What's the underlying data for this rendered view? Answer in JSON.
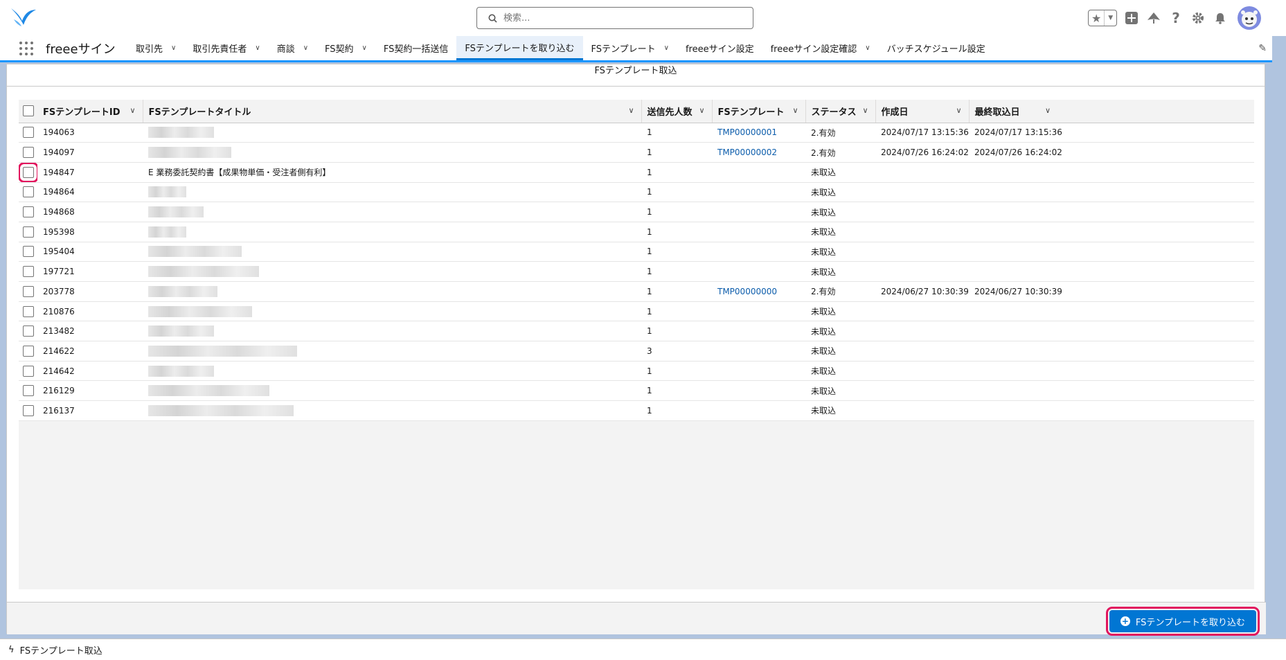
{
  "search": {
    "placeholder": "検索..."
  },
  "nav": {
    "app_name": "freeeサイン",
    "tabs": [
      {
        "label": "取引先",
        "has_menu": true,
        "active": false
      },
      {
        "label": "取引先責任者",
        "has_menu": true,
        "active": false
      },
      {
        "label": "商談",
        "has_menu": true,
        "active": false
      },
      {
        "label": "FS契約",
        "has_menu": true,
        "active": false
      },
      {
        "label": "FS契約一括送信",
        "has_menu": false,
        "active": false
      },
      {
        "label": "FSテンプレートを取り込む",
        "has_menu": false,
        "active": true
      },
      {
        "label": "FSテンプレート",
        "has_menu": true,
        "active": false
      },
      {
        "label": "freeeサイン設定",
        "has_menu": false,
        "active": false
      },
      {
        "label": "freeeサイン設定確認",
        "has_menu": true,
        "active": false
      },
      {
        "label": "バッチスケジュール設定",
        "has_menu": false,
        "active": false
      }
    ]
  },
  "panel": {
    "title": "FSテンプレート取込"
  },
  "table": {
    "headers": {
      "id": "FSテンプレートID",
      "title": "FSテンプレートタイトル",
      "recipients": "送信先人数",
      "template": "FSテンプレート",
      "status": "ステータス",
      "created": "作成日",
      "last_import": "最終取込日"
    },
    "rows": [
      {
        "id": "194063",
        "title": "",
        "blur_w": 95,
        "recipients": "1",
        "template": "TMP00000001",
        "status": "2.有効",
        "created": "2024/07/17 13:15:36",
        "last_import": "2024/07/17 13:15:36"
      },
      {
        "id": "194097",
        "title": "",
        "blur_w": 120,
        "recipients": "1",
        "template": "TMP00000002",
        "status": "2.有効",
        "created": "2024/07/26 16:24:02",
        "last_import": "2024/07/26 16:24:02"
      },
      {
        "id": "194847",
        "title": "E 業務委託契約書【成果物単価・受注者側有利】",
        "blur_w": 0,
        "recipients": "1",
        "template": "",
        "status": "未取込",
        "created": "",
        "last_import": "",
        "highlight": true
      },
      {
        "id": "194864",
        "title": "",
        "blur_w": 55,
        "recipients": "1",
        "template": "",
        "status": "未取込",
        "created": "",
        "last_import": ""
      },
      {
        "id": "194868",
        "title": "",
        "blur_w": 80,
        "recipients": "1",
        "template": "",
        "status": "未取込",
        "created": "",
        "last_import": ""
      },
      {
        "id": "195398",
        "title": "",
        "blur_w": 55,
        "recipients": "1",
        "template": "",
        "status": "未取込",
        "created": "",
        "last_import": ""
      },
      {
        "id": "195404",
        "title": "",
        "blur_w": 135,
        "recipients": "1",
        "template": "",
        "status": "未取込",
        "created": "",
        "last_import": ""
      },
      {
        "id": "197721",
        "title": "",
        "blur_w": 160,
        "recipients": "1",
        "template": "",
        "status": "未取込",
        "created": "",
        "last_import": ""
      },
      {
        "id": "203778",
        "title": "",
        "blur_w": 100,
        "recipients": "1",
        "template": "TMP00000000",
        "status": "2.有効",
        "created": "2024/06/27 10:30:39",
        "last_import": "2024/06/27 10:30:39"
      },
      {
        "id": "210876",
        "title": "",
        "blur_w": 150,
        "recipients": "1",
        "template": "",
        "status": "未取込",
        "created": "",
        "last_import": ""
      },
      {
        "id": "213482",
        "title": "",
        "blur_w": 95,
        "recipients": "1",
        "template": "",
        "status": "未取込",
        "created": "",
        "last_import": ""
      },
      {
        "id": "214622",
        "title": "",
        "blur_w": 215,
        "recipients": "3",
        "template": "",
        "status": "未取込",
        "created": "",
        "last_import": ""
      },
      {
        "id": "214642",
        "title": "",
        "blur_w": 95,
        "recipients": "1",
        "template": "",
        "status": "未取込",
        "created": "",
        "last_import": ""
      },
      {
        "id": "216129",
        "title": "",
        "blur_w": 175,
        "recipients": "1",
        "template": "",
        "status": "未取込",
        "created": "",
        "last_import": ""
      },
      {
        "id": "216137",
        "title": "",
        "blur_w": 210,
        "recipients": "1",
        "template": "",
        "status": "未取込",
        "created": "",
        "last_import": ""
      }
    ]
  },
  "actions": {
    "import_button": "FSテンプレートを取り込む"
  },
  "utility": {
    "label": "FSテンプレート取込"
  },
  "colors": {
    "brand": "#0176d3",
    "highlight": "#e2165e",
    "link": "#0b5cab"
  }
}
